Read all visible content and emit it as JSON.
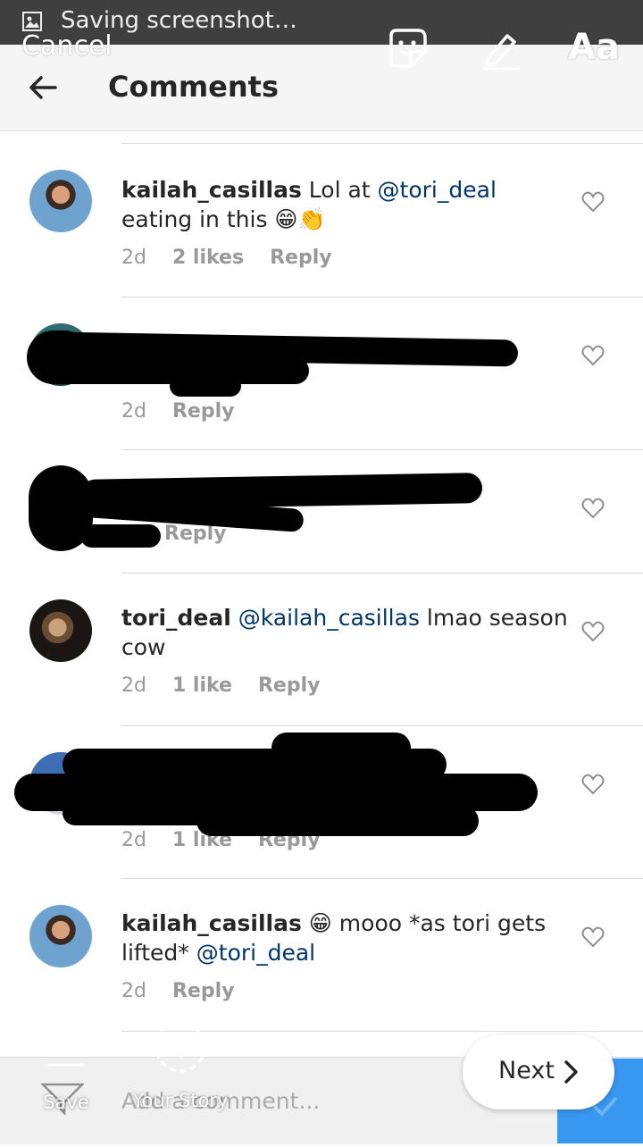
{
  "status_bar": {
    "text": "Saving screenshot…",
    "icon": "image-icon"
  },
  "editor": {
    "cancel_label": "Cancel",
    "text_tool_label": "Aa",
    "save_label": "Save",
    "your_story_label": "Your Story",
    "next_label": "Next"
  },
  "header": {
    "title": "Comments",
    "back_icon": "back-arrow-icon"
  },
  "comments": [
    {
      "username": "kailah_casillas",
      "text_before": "Lol at ",
      "mention": "@tori_deal",
      "text_after": " eating in this 😁👏",
      "time": "2d",
      "likes": "2 likes",
      "reply": "Reply"
    },
    {
      "time": "2d",
      "reply": "Reply",
      "redacted": true
    },
    {
      "reply": "Reply",
      "redacted": true
    },
    {
      "username": "tori_deal",
      "text_before": " ",
      "mention": "@kailah_casillas",
      "text_after": " lmao season cow",
      "time": "2d",
      "likes": "1 like",
      "reply": "Reply"
    },
    {
      "time": "2d",
      "likes": "1 like",
      "reply": "Reply",
      "redacted": true
    },
    {
      "username": "kailah_casillas",
      "text_before": " 😁 mooo *as tori gets lifted* ",
      "mention": "@tori_deal",
      "text_after": "",
      "time": "2d",
      "reply": "Reply"
    }
  ],
  "composer": {
    "placeholder": "Add a comment..."
  },
  "colors": {
    "mention": "#003569",
    "accent": "#3897f0",
    "meta": "#999999"
  }
}
